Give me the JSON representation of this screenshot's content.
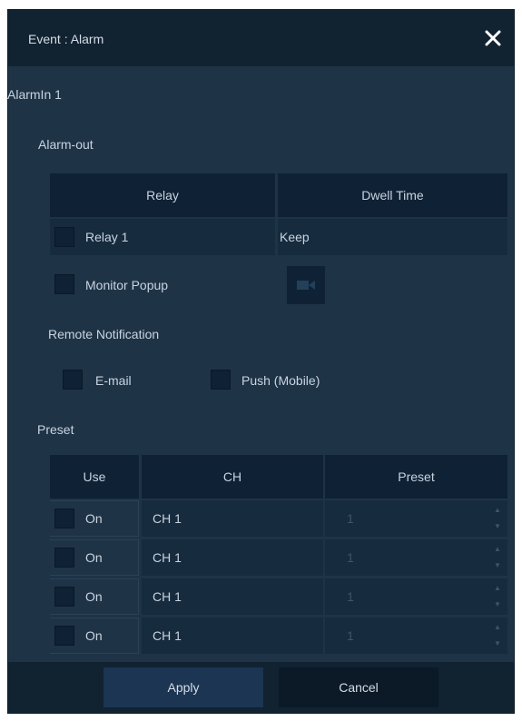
{
  "dialog": {
    "title": "Event : Alarm",
    "close_icon": "close-icon"
  },
  "alarm_in": "AlarmIn 1",
  "alarm_out": {
    "section_label": "Alarm-out",
    "headers": {
      "relay": "Relay",
      "dwell_time": "Dwell Time"
    },
    "row": {
      "relay": "Relay 1",
      "dwell_time": "Keep"
    },
    "monitor_popup_label": "Monitor Popup",
    "camera_icon": "camera-icon"
  },
  "remote_notification": {
    "section_label": "Remote Notification",
    "email_label": "E-mail",
    "push_label": "Push (Mobile)"
  },
  "preset": {
    "section_label": "Preset",
    "headers": {
      "use": "Use",
      "ch": "CH",
      "preset": "Preset"
    },
    "rows": [
      {
        "use": "On",
        "ch": "CH 1",
        "preset": "1"
      },
      {
        "use": "On",
        "ch": "CH 1",
        "preset": "1"
      },
      {
        "use": "On",
        "ch": "CH 1",
        "preset": "1"
      },
      {
        "use": "On",
        "ch": "CH 1",
        "preset": "1"
      }
    ]
  },
  "footer": {
    "apply_label": "Apply",
    "cancel_label": "Cancel"
  }
}
